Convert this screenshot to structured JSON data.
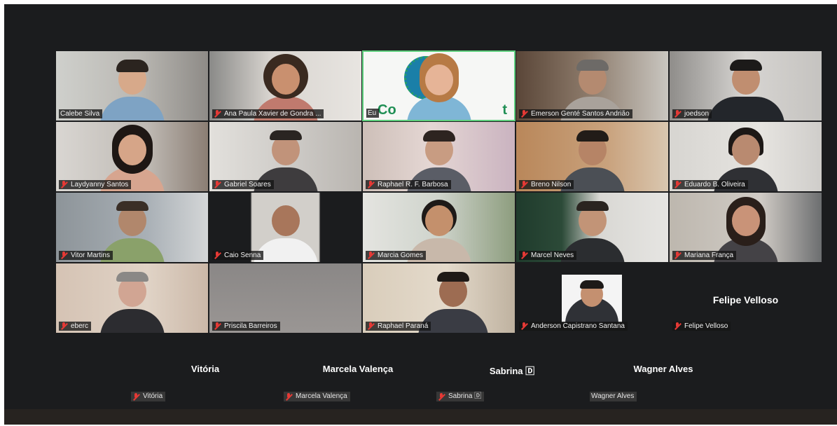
{
  "participants": [
    {
      "name": "Calebe Silva",
      "muted": false
    },
    {
      "name": "Ana Paula Xavier de Gondra ...",
      "muted": true
    },
    {
      "name": "Eu",
      "muted": false
    },
    {
      "name": "Emerson Genté Santos Andrião",
      "muted": true
    },
    {
      "name": "joedson",
      "muted": true
    },
    {
      "name": "Laydyanny Santos",
      "muted": true
    },
    {
      "name": "Gabriel Soares",
      "muted": true
    },
    {
      "name": "Raphael R. F. Barbosa",
      "muted": true
    },
    {
      "name": "Breno Nilson",
      "muted": true
    },
    {
      "name": "Eduardo B. Oliveira",
      "muted": true
    },
    {
      "name": "Vitor Martins",
      "muted": true
    },
    {
      "name": "Caio Senna",
      "muted": true
    },
    {
      "name": "Marcia Gomes",
      "muted": true
    },
    {
      "name": "Marcel Neves",
      "muted": true
    },
    {
      "name": "Mariana França",
      "muted": true
    },
    {
      "name": "eberc",
      "muted": true
    },
    {
      "name": "Priscila Barreiros",
      "muted": true
    },
    {
      "name": "Raphael Paraná",
      "muted": true
    },
    {
      "name": "Anderson Capistrano Santana",
      "muted": true
    },
    {
      "name": "Felipe Velloso",
      "muted": true
    }
  ],
  "felipe_big_name": "Felipe Velloso",
  "no_video_participants": [
    {
      "big_name": "Vitória",
      "tag": "Vitória",
      "muted": true
    },
    {
      "big_name": "Marcela Valença",
      "tag": "Marcela Valença",
      "muted": true
    },
    {
      "big_name": "Sabrina 🄳",
      "tag": "Sabrina 🄳",
      "muted": true
    },
    {
      "big_name": "Wagner Alves",
      "tag": "Wagner Alves",
      "muted": false
    }
  ],
  "colors": {
    "background": "#1b1c1e",
    "active_speaker_border": "#5fd07e",
    "muted_icon": "#e53935"
  }
}
